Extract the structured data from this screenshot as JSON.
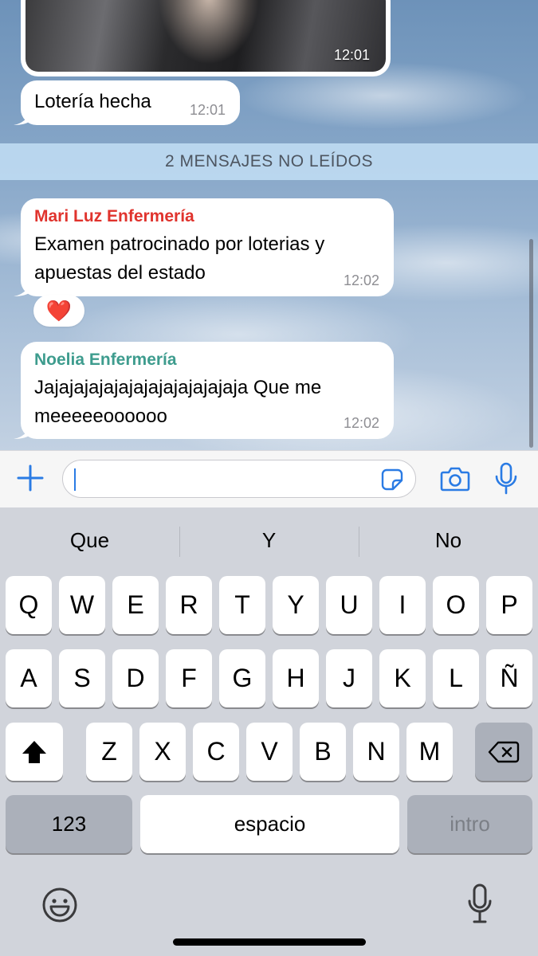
{
  "chat": {
    "photo_message": {
      "time": "12:01"
    },
    "messages": [
      {
        "text": "Lotería hecha",
        "time": "12:01"
      },
      {
        "sender": "Mari Luz Enfermería",
        "sender_color": "#e0332d",
        "text_line1": "Examen patrocinado por loterias y",
        "text_line2": "apuestas del estado",
        "time": "12:02",
        "reaction": "❤️"
      },
      {
        "sender": "Noelia Enfermería",
        "sender_color": "#3e9c8e",
        "text_line1": "Jajajajajajajajajajajajajaja Que me",
        "text_line2": "meeeeeoooooo",
        "time": "12:02"
      }
    ],
    "unread_banner": "2 MENSAJES NO LEÍDOS"
  },
  "input_bar": {
    "placeholder": "",
    "icons": [
      "plus-icon",
      "sticker-icon",
      "camera-icon",
      "microphone-icon"
    ],
    "accent_color": "#2a7be4"
  },
  "keyboard": {
    "suggestions": [
      "Que",
      "Y",
      "No"
    ],
    "row1": [
      "Q",
      "W",
      "E",
      "R",
      "T",
      "Y",
      "U",
      "I",
      "O",
      "P"
    ],
    "row2": [
      "A",
      "S",
      "D",
      "F",
      "G",
      "H",
      "J",
      "K",
      "L",
      "Ñ"
    ],
    "row3": [
      "Z",
      "X",
      "C",
      "V",
      "B",
      "N",
      "M"
    ],
    "numbers_label": "123",
    "space_label": "espacio",
    "return_label": "intro",
    "icons": [
      "shift-icon",
      "backspace-icon",
      "emoji-icon",
      "dictation-icon"
    ]
  }
}
